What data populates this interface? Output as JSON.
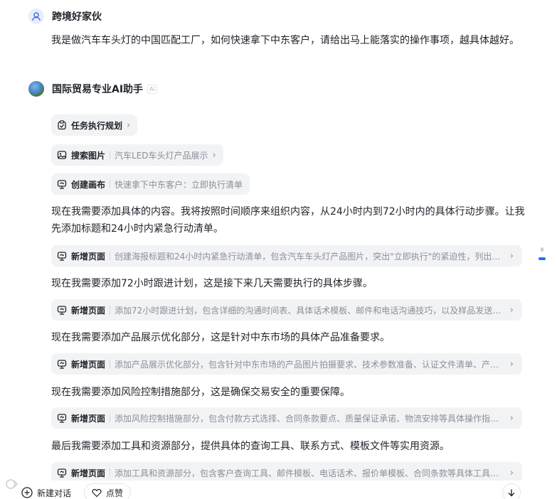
{
  "user": {
    "name": "跨境好家伙",
    "message": "我是做汽车车头灯的中国匹配工厂，如何快速拿下中东客户，请给出马上能落实的操作事项，越具体越好。"
  },
  "assistant": {
    "name": "国际贸易专业AI助手",
    "badge": "AI"
  },
  "chips": [
    {
      "title": "任务执行规划",
      "desc": "",
      "icon": "clipboard-icon"
    },
    {
      "title": "搜索图片",
      "desc": "汽车LED车头灯产品展示",
      "icon": "image-search-icon"
    },
    {
      "title": "创建画布",
      "desc": "快速拿下中东客户：立即执行清单",
      "icon": "canvas-icon"
    }
  ],
  "steps": [
    {
      "text": "现在我需要添加具体的内容。我将按照时间顺序来组织内容，从24小时内到72小时内的具体行动步骤。让我先添加标题和24小时内紧急行动清单。",
      "chip_title": "新增页面",
      "chip_desc": "创建海报标题和24小时内紧急行动清单，包含汽车车头灯产品图片，突出\"立即执行\"的紧迫性，列出客户..."
    },
    {
      "text": "现在我需要添加72小时跟进计划，这是接下来几天需要执行的具体步骤。",
      "chip_title": "新增页面",
      "chip_desc": "添加72小时跟进计划，包含详细的沟通时间表、具体话术模板、邮件和电话沟通技巧，以及样品发送安..."
    },
    {
      "text": "现在我需要添加产品展示优化部分，这是针对中东市场的具体产品准备要求。",
      "chip_title": "新增页面",
      "chip_desc": "添加产品展示优化部分，包含针对中东市场的产品图片拍摄要求、技术参数准备、认证文件清单、产品说..."
    },
    {
      "text": "现在我需要添加风险控制措施部分，这是确保交易安全的重要保障。",
      "chip_title": "新增页面",
      "chip_desc": "添加风险控制措施部分，包含付款方式选择、合同条款要点、质量保证承诺、物流安排等具体操作指南和..."
    },
    {
      "text": "最后我需要添加工具和资源部分，提供具体的查询工具、联系方式、模板文件等实用资源。",
      "chip_title": "新增页面",
      "chip_desc": "添加工具和资源部分，包含客户查询工具、邮件模板、电话话术、报价单模板、合同条款等具体工具和资..."
    }
  ],
  "bottom": {
    "new_chat": "新建对话",
    "like": "点赞"
  },
  "colors": {
    "accent": "#2a6cf6",
    "chip_bg": "#f2f3f5",
    "muted": "#8a8f99"
  }
}
